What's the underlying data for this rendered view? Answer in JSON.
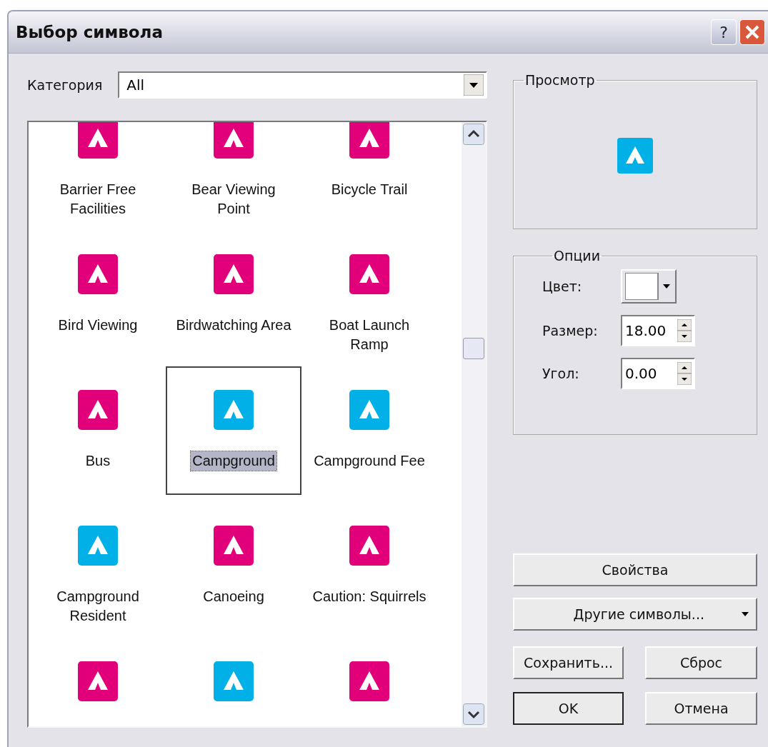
{
  "window": {
    "title": "Выбор символа",
    "help_button": "?"
  },
  "category": {
    "label": "Категория",
    "value": "All"
  },
  "symbols": [
    {
      "label": "Barrier Free Facilities",
      "color": "#e2007a",
      "selected": false
    },
    {
      "label": "Bear Viewing Point",
      "color": "#e2007a",
      "selected": false
    },
    {
      "label": "Bicycle Trail",
      "color": "#e2007a",
      "selected": false
    },
    {
      "label": "Bird Viewing",
      "color": "#e2007a",
      "selected": false
    },
    {
      "label": "Birdwatching Area",
      "color": "#e2007a",
      "selected": false
    },
    {
      "label": "Boat Launch Ramp",
      "color": "#e2007a",
      "selected": false
    },
    {
      "label": "Bus",
      "color": "#e2007a",
      "selected": false
    },
    {
      "label": "Campground",
      "color": "#00b0e6",
      "selected": true
    },
    {
      "label": "Campground Fee",
      "color": "#00b0e6",
      "selected": false
    },
    {
      "label": "Campground Resident",
      "color": "#00b0e6",
      "selected": false
    },
    {
      "label": "Canoeing",
      "color": "#e2007a",
      "selected": false
    },
    {
      "label": "Caution: Squirrels",
      "color": "#e2007a",
      "selected": false
    },
    {
      "color": "#e2007a",
      "selected": false
    },
    {
      "color": "#00b0e6",
      "selected": false
    },
    {
      "color": "#e2007a",
      "selected": false
    }
  ],
  "preview": {
    "title": "Просмотр",
    "color": "#00b0e6"
  },
  "options": {
    "title": "Опции",
    "color_label": "Цвет:",
    "size_label": "Размер:",
    "size": "18.00",
    "angle_label": "Угол:",
    "angle": "0.00"
  },
  "buttons": {
    "properties": "Свойства",
    "more_symbols": "Другие символы...",
    "save": "Сохранить...",
    "reset": "Сброс",
    "ok": "OK",
    "cancel": "Отмена"
  }
}
